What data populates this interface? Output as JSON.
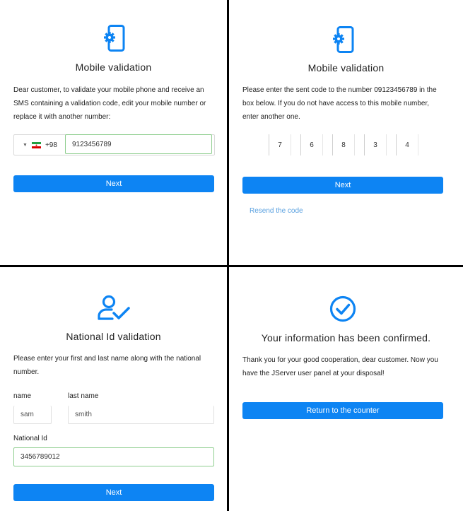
{
  "colors": {
    "accent": "#0d84f3",
    "link": "#5aa1e0",
    "valid_border": "#8fce8f"
  },
  "panel1": {
    "icon": "phone-settings-icon",
    "title": "Mobile validation",
    "description_lines": [
      "Dear customer, to validate your mobile phone and receive an",
      "SMS containing a validation code, edit your mobile number or",
      "replace it with another number:"
    ],
    "country_flag": "iran-flag-icon",
    "country_code": "+98",
    "phone_value": "9123456789",
    "next_label": "Next"
  },
  "panel2": {
    "icon": "phone-settings-icon",
    "title": "Mobile validation",
    "description_lines": [
      "Please enter the sent code to the number 09123456789 in the",
      "box below. If you do not have access to this mobile number,",
      "enter another one."
    ],
    "code_digits": [
      "7",
      "6",
      "8",
      "3",
      "4"
    ],
    "next_label": "Next",
    "resend_label": "Resend the code"
  },
  "panel3": {
    "icon": "user-check-icon",
    "title": "National Id validation",
    "description_lines": [
      "Please enter your first and last name along with the national",
      "number."
    ],
    "name_label": "name",
    "name_value": "sam",
    "lastname_label": "last name",
    "lastname_value": "smith",
    "national_id_label": "National Id",
    "national_id_value": "3456789012",
    "next_label": "Next"
  },
  "panel4": {
    "icon": "check-circle-icon",
    "title": "Your information has been confirmed.",
    "description_lines": [
      "Thank you for your good cooperation, dear customer. Now you",
      "have the JServer user panel at your disposal!"
    ],
    "return_label": "Return to the counter"
  }
}
